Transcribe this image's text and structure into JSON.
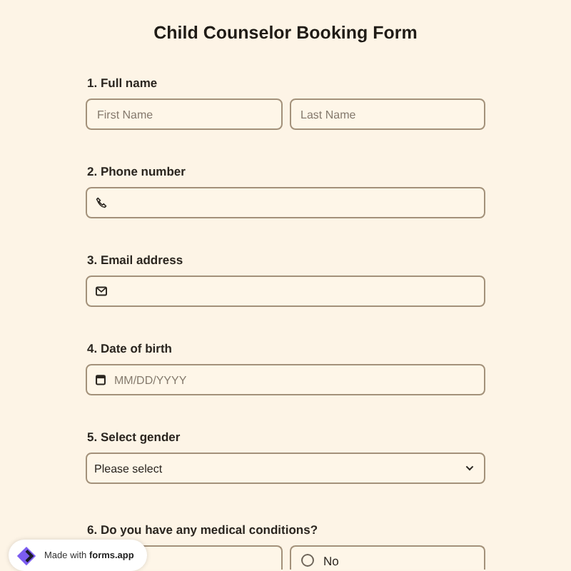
{
  "title": "Child Counselor Booking Form",
  "questions": [
    {
      "kind": "name",
      "number": "1.",
      "label": "Full name",
      "fields": [
        {
          "placeholder": "First Name"
        },
        {
          "placeholder": "Last Name"
        }
      ]
    },
    {
      "kind": "phone",
      "number": "2.",
      "label": "Phone number"
    },
    {
      "kind": "email",
      "number": "3.",
      "label": "Email address"
    },
    {
      "kind": "date",
      "number": "4.",
      "label": "Date of birth",
      "placeholder": "MM/DD/YYYY"
    },
    {
      "kind": "select",
      "number": "5.",
      "label": "Select gender",
      "value": "Please select"
    },
    {
      "kind": "radio",
      "number": "6.",
      "label": "Do you have any medical conditions?",
      "options": [
        {
          "kind": "covered"
        },
        {
          "kind": "radio",
          "label": "No",
          "selected": false
        }
      ]
    }
  ],
  "badge": "Made with **forms.app**"
}
